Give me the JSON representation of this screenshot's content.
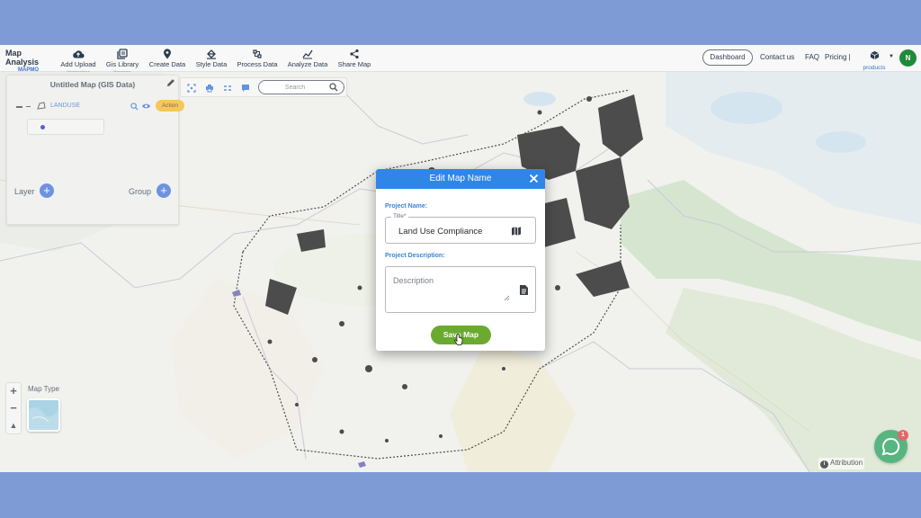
{
  "colors": {
    "frame": "#7f9bd6",
    "accent": "#3d6fd6",
    "modal_header": "#2f86e6",
    "save_button": "#6aaa2e",
    "action_button": "#f0b429",
    "avatar": "#1f8a3b",
    "chat": "#1f9d55"
  },
  "brand": {
    "title": "Map Analysis",
    "logo_text": "MAPMO"
  },
  "toolbar": [
    {
      "label": "Add Upload",
      "sub": "Mapping/Input",
      "icon": "cloud-upload-icon"
    },
    {
      "label": "Gis Library",
      "sub": "Basemaps",
      "icon": "library-icon"
    },
    {
      "label": "Create Data",
      "sub": "",
      "icon": "location-pin-icon"
    },
    {
      "label": "Style Data",
      "sub": "",
      "icon": "paint-bucket-icon"
    },
    {
      "label": "Process Data",
      "sub": "",
      "icon": "process-icon"
    },
    {
      "label": "Analyze Data",
      "sub": "",
      "icon": "analyze-icon"
    },
    {
      "label": "Share Map",
      "sub": "",
      "icon": "share-icon"
    }
  ],
  "nav": {
    "dashboard": "Dashboard",
    "contact": "Contact us",
    "faq": "FAQ",
    "pricing": "Pricing |",
    "products": "products",
    "avatar_letter": "N"
  },
  "panel": {
    "title": "Untitled Map (GIS Data)",
    "layer_name": "LANDUSE",
    "action_label": "Action",
    "layer_label": "Layer",
    "group_label": "Group"
  },
  "search": {
    "placeholder": "Search"
  },
  "map_type": {
    "label": "Map Type"
  },
  "attribution": "Attribution",
  "chat": {
    "badge_count": "1"
  },
  "modal": {
    "title": "Edit Map Name",
    "project_name_label": "Project Name:",
    "title_field_label": "Title*",
    "title_value": "Land Use Compliance",
    "project_description_label": "Project Description:",
    "description_placeholder": "Description",
    "description_value": "",
    "save_label": "Save Map"
  }
}
